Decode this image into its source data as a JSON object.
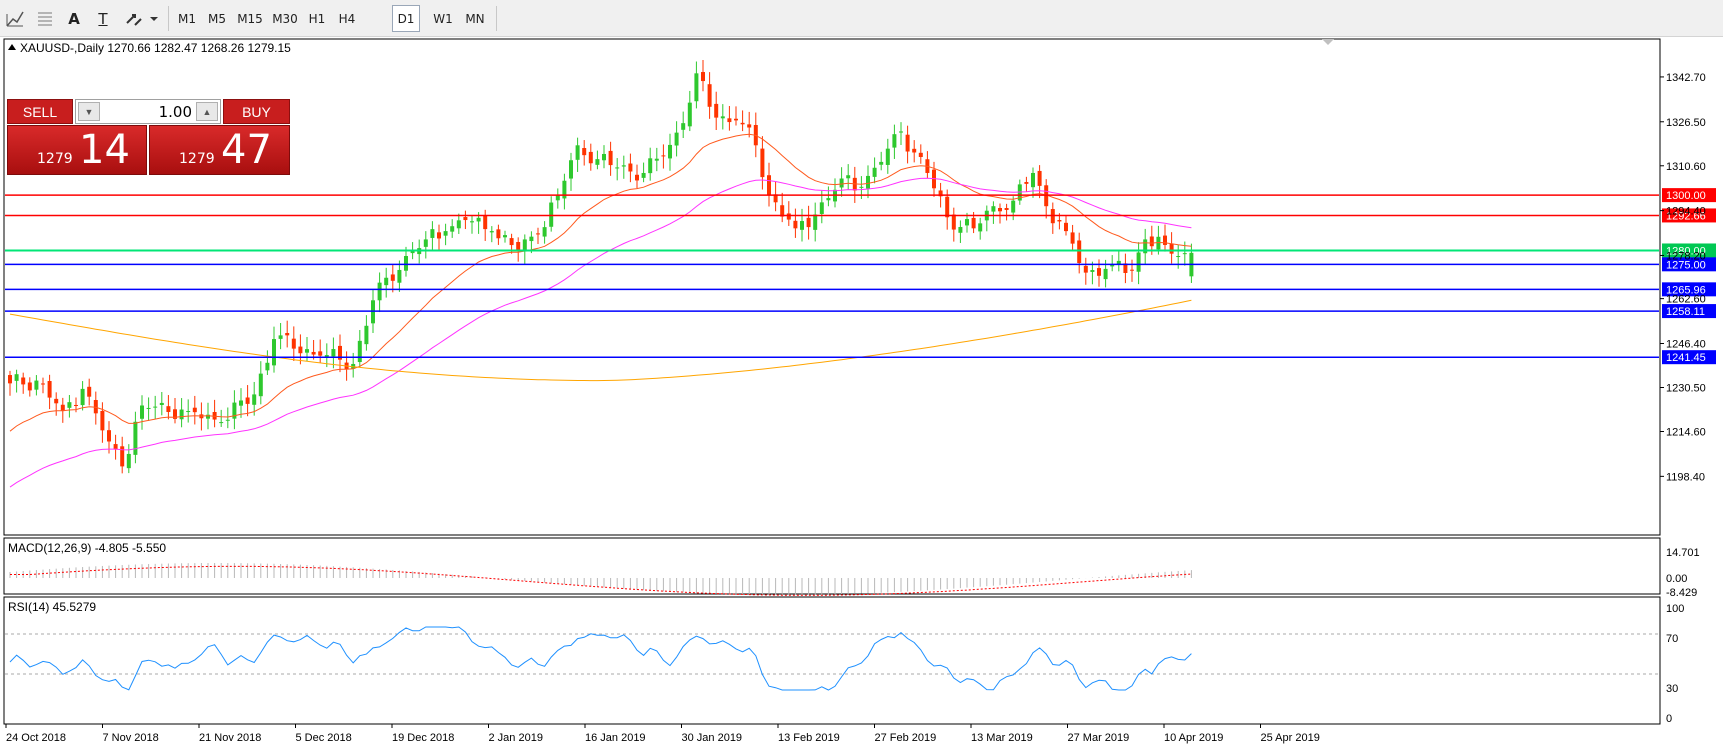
{
  "toolbar": {
    "tools": [
      {
        "name": "indicators-list-icon"
      },
      {
        "name": "objects-list-icon"
      },
      {
        "name": "text-tool-icon",
        "glyph": "A"
      },
      {
        "name": "text-label-tool-icon",
        "glyph": "T"
      },
      {
        "name": "arrows-tool-icon"
      }
    ],
    "periods": [
      "M1",
      "M5",
      "M15",
      "M30",
      "H1",
      "H4",
      "D1",
      "W1",
      "MN"
    ],
    "active_period": "D1"
  },
  "chart": {
    "header": "XAUUSD-,Daily  1270.66 1282.47 1268.26 1279.15",
    "price_axis": [
      "1342.70",
      "1326.50",
      "1310.60",
      "1294.40",
      "1278.20",
      "1262.60",
      "1246.40",
      "1230.50",
      "1214.60",
      "1198.40"
    ],
    "dates": [
      "24 Oct 2018",
      "7 Nov 2018",
      "21 Nov 2018",
      "5 Dec 2018",
      "19 Dec 2018",
      "2 Jan 2019",
      "16 Jan 2019",
      "30 Jan 2019",
      "13 Feb 2019",
      "27 Feb 2019",
      "13 Mar 2019",
      "27 Mar 2019",
      "10 Apr 2019",
      "25 Apr 2019"
    ],
    "levels": [
      {
        "value": 1300.0,
        "label": "1300.00",
        "color": "#ff0000"
      },
      {
        "value": 1292.66,
        "label": "1292.66",
        "color": "#ff0000"
      },
      {
        "value": 1280.0,
        "label": "1280.00",
        "color": "#00e676"
      },
      {
        "value": 1275.0,
        "label": "1275.00",
        "color": "#0000ff"
      },
      {
        "value": 1265.96,
        "label": "1265.96",
        "color": "#0000ff"
      },
      {
        "value": 1258.11,
        "label": "1258.11",
        "color": "#0000ff"
      },
      {
        "value": 1241.45,
        "label": "1241.45",
        "color": "#0000ff"
      }
    ],
    "colors": {
      "bull": "#2ec82e",
      "bear": "#ff3300",
      "ma_fast": "#ff5a1e",
      "ma_mid": "#ff33ff",
      "ma_slow": "#ffa500"
    }
  },
  "macd": {
    "label": "MACD(12,26,9) -4.805 -5.550",
    "axis": [
      "14.701",
      "0.00",
      "-8.429"
    ]
  },
  "rsi": {
    "label": "RSI(14) 45.5279",
    "axis": [
      "100",
      "70",
      "30",
      "0"
    ]
  },
  "trade": {
    "sell_label": "SELL",
    "buy_label": "BUY",
    "lot": "1.00",
    "sell_small": "1279",
    "sell_big": "14",
    "buy_small": "1279",
    "buy_big": "47"
  },
  "chart_data": {
    "type": "candlestick",
    "symbol": "XAUUSD-",
    "timeframe": "Daily",
    "last_bar": {
      "open": 1270.66,
      "high": 1282.47,
      "low": 1268.26,
      "close": 1279.15
    },
    "anchor_closes": [
      [
        0,
        1232
      ],
      [
        4,
        1233
      ],
      [
        8,
        1222
      ],
      [
        11,
        1230
      ],
      [
        15,
        1211
      ],
      [
        17,
        1202
      ],
      [
        20,
        1224
      ],
      [
        27,
        1222
      ],
      [
        32,
        1218
      ],
      [
        37,
        1228
      ],
      [
        40,
        1248
      ],
      [
        47,
        1242
      ],
      [
        52,
        1239
      ],
      [
        55,
        1262
      ],
      [
        60,
        1278
      ],
      [
        63,
        1284
      ],
      [
        66,
        1287
      ],
      [
        69,
        1291
      ],
      [
        73,
        1287
      ],
      [
        77,
        1280
      ],
      [
        80,
        1286
      ],
      [
        83,
        1300
      ],
      [
        86,
        1318
      ],
      [
        89,
        1313
      ],
      [
        92,
        1310
      ],
      [
        96,
        1308
      ],
      [
        99,
        1314
      ],
      [
        102,
        1326
      ],
      [
        104,
        1344
      ],
      [
        107,
        1328
      ],
      [
        110,
        1327
      ],
      [
        113,
        1318
      ],
      [
        115,
        1300
      ],
      [
        119,
        1288
      ],
      [
        122,
        1293
      ],
      [
        126,
        1306
      ],
      [
        129,
        1303
      ],
      [
        132,
        1312
      ],
      [
        135,
        1323
      ],
      [
        139,
        1308
      ],
      [
        142,
        1292
      ],
      [
        146,
        1288
      ],
      [
        149,
        1296
      ],
      [
        152,
        1298
      ],
      [
        155,
        1308
      ],
      [
        157,
        1296
      ],
      [
        160,
        1287
      ],
      [
        163,
        1272
      ],
      [
        167,
        1275
      ],
      [
        170,
        1273
      ],
      [
        172,
        1284
      ],
      [
        175,
        1282
      ],
      [
        177,
        1278
      ],
      [
        179,
        1279.15
      ]
    ],
    "ylim": [
      1192,
      1352
    ]
  }
}
